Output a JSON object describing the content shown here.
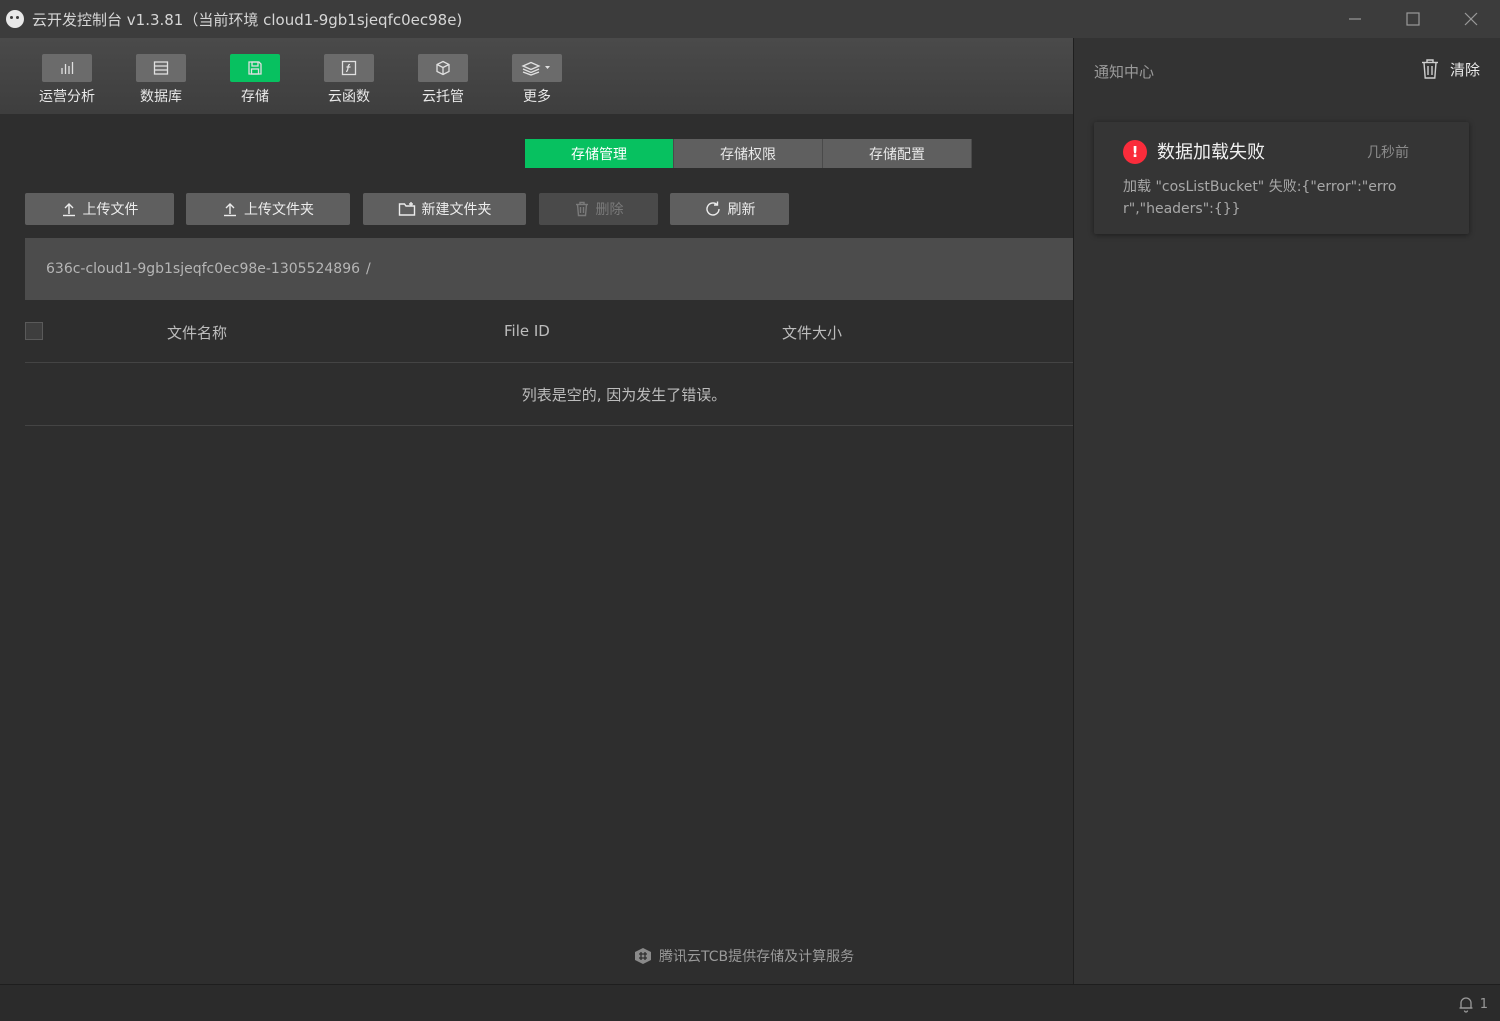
{
  "window": {
    "title": "云开发控制台 v1.3.81（当前环境 cloud1-9gb1sjeqfc0ec98e)",
    "controls": [
      "minimize-icon",
      "maximize-icon",
      "close-icon"
    ]
  },
  "toolbar": {
    "items": [
      {
        "label": "运营分析",
        "icon": "chart-icon",
        "active": false
      },
      {
        "label": "数据库",
        "icon": "database-icon",
        "active": false
      },
      {
        "label": "存储",
        "icon": "save-icon",
        "active": true
      },
      {
        "label": "云函数",
        "icon": "function-icon",
        "active": false
      },
      {
        "label": "云托管",
        "icon": "cube-icon",
        "active": false
      },
      {
        "label": "更多",
        "icon": "layers-icon",
        "active": false
      }
    ]
  },
  "subtabs": [
    {
      "label": "存储管理",
      "active": true
    },
    {
      "label": "存储权限",
      "active": false
    },
    {
      "label": "存储配置",
      "active": false
    }
  ],
  "actions": {
    "upload_file": "上传文件",
    "upload_folder": "上传文件夹",
    "new_folder": "新建文件夹",
    "delete": "删除",
    "refresh": "刷新"
  },
  "path": {
    "bucket": "636c-cloud1-9gb1sjeqfc0ec98e-1305524896",
    "separator": "/"
  },
  "table": {
    "columns": [
      "文件名称",
      "File ID",
      "文件大小"
    ],
    "empty_message": "列表是空的, 因为发生了错误。"
  },
  "footer": {
    "credit": "腾讯云TCB提供存储及计算服务"
  },
  "notifications": {
    "title": "通知中心",
    "clear_label": "清除",
    "items": [
      {
        "title": "数据加载失败",
        "time": "几秒前",
        "message": "加载 \"cosListBucket\" 失败:{\"error\":\"error\",\"headers\":{}}"
      }
    ]
  },
  "statusbar": {
    "notification_count": "1"
  },
  "colors": {
    "accent": "#07c160",
    "error": "#fa2c3b",
    "background": "#2e2e2e"
  }
}
